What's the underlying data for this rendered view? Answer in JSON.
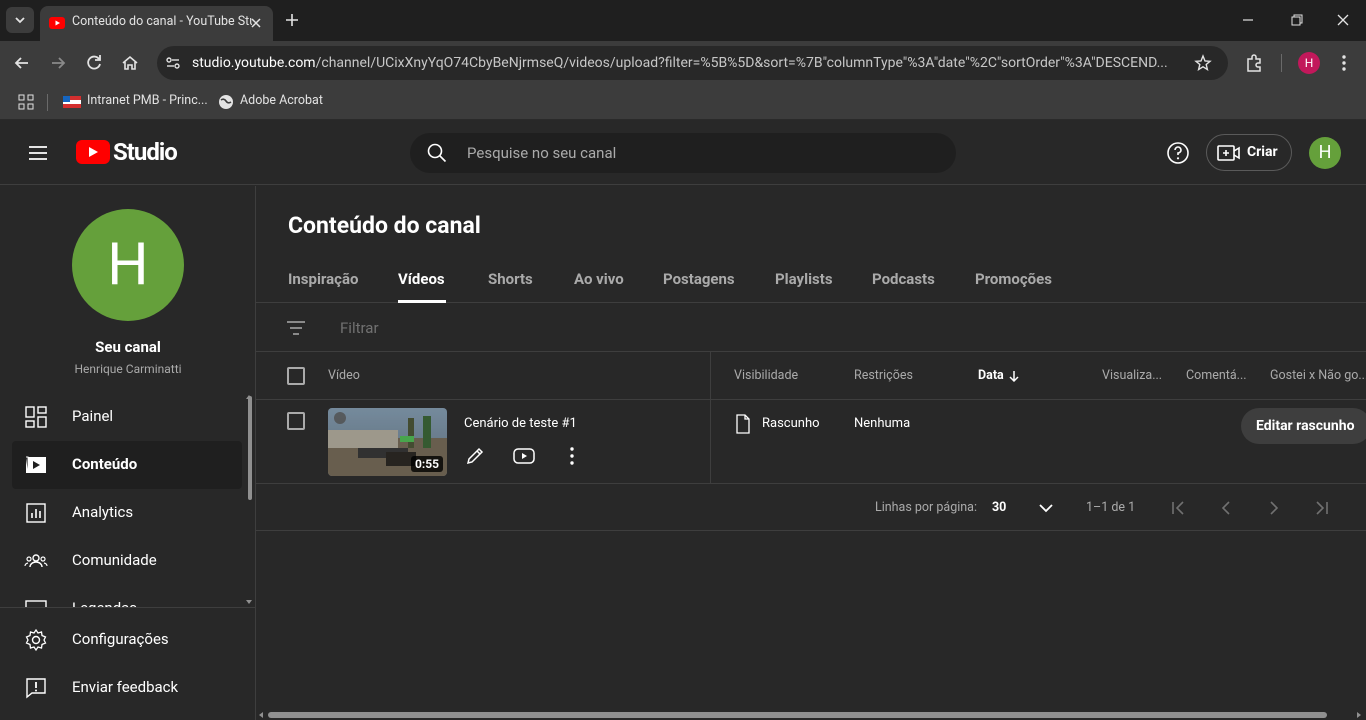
{
  "browser": {
    "tab_title": "Conteúdo do canal - YouTube Studio",
    "url_host": "studio.youtube.com",
    "url_path": "/channel/UCixXnyYqO74CbyBeNjrmseQ/videos/upload?filter=%5B%5D&sort=%7B\"columnType\"%3A\"date\"%2C\"sortOrder\"%3A\"DESCEND...",
    "profile_initial": "H",
    "bookmarks": [
      {
        "label": "Intranet PMB - Princ...",
        "icon": "flag-icon"
      },
      {
        "label": "Adobe Acrobat",
        "icon": "globe-icon"
      }
    ]
  },
  "header": {
    "logo_text": "Studio",
    "search_placeholder": "Pesquise no seu canal",
    "create_label": "Criar",
    "avatar_initial": "H"
  },
  "sidebar": {
    "avatar_initial": "H",
    "channel_title": "Seu canal",
    "channel_name": "Henrique Carminatti",
    "items": [
      {
        "label": "Painel",
        "icon": "dashboard-icon"
      },
      {
        "label": "Conteúdo",
        "icon": "content-icon",
        "active": true
      },
      {
        "label": "Analytics",
        "icon": "analytics-icon"
      },
      {
        "label": "Comunidade",
        "icon": "community-icon"
      },
      {
        "label": "Legendas",
        "icon": "subtitles-icon"
      }
    ],
    "bottom_items": [
      {
        "label": "Configurações",
        "icon": "gear-icon"
      },
      {
        "label": "Enviar feedback",
        "icon": "feedback-icon"
      }
    ]
  },
  "main": {
    "title": "Conteúdo do canal",
    "tabs": [
      "Inspiração",
      "Vídeos",
      "Shorts",
      "Ao vivo",
      "Postagens",
      "Playlists",
      "Podcasts",
      "Promoções"
    ],
    "active_tab": "Vídeos",
    "filter_placeholder": "Filtrar",
    "columns": {
      "video": "Vídeo",
      "visibility": "Visibilidade",
      "restrictions": "Restrições",
      "date": "Data",
      "views": "Visualiza...",
      "comments": "Comentá...",
      "likes": "Gostei x Não go..."
    },
    "rows": [
      {
        "title": "Cenário de teste #1",
        "duration": "0:55",
        "visibility": "Rascunho",
        "restrictions": "Nenhuma",
        "action": "Editar rascunho"
      }
    ],
    "pagination": {
      "rows_label": "Linhas por página:",
      "rows_value": "30",
      "range": "1–1 de 1"
    }
  },
  "colors": {
    "background": "#282828",
    "youtube_red": "#ff0000",
    "avatar_green": "#65a03b"
  }
}
